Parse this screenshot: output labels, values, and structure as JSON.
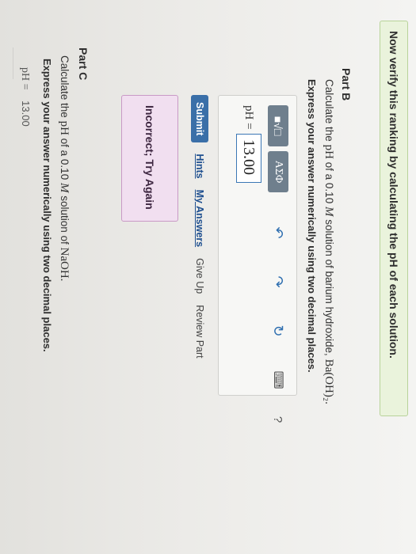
{
  "hint_banner": "Now verify this ranking by calculating the pH of each solution.",
  "part_b": {
    "heading": "Part B",
    "prompt_pre": "Calculate the ",
    "prompt_ph": "pH",
    "prompt_mid": " of a 0.10 ",
    "prompt_m": "M",
    "prompt_post": " solution of barium hydroxide, ",
    "prompt_formula": "Ba(OH)₂.",
    "instruction": "Express your answer numerically using two decimal places.",
    "toolbar": {
      "templates_label": "■√□",
      "greek_label": "ΑΣΦ",
      "undo_glyph": "↶",
      "redo_glyph": "↷",
      "reset_glyph": "↻",
      "keyboard_glyph": "⌨",
      "help_glyph": "?"
    },
    "input_label": "pH =",
    "input_value": "13.00",
    "submit_label": "Submit",
    "hints_label": "Hints",
    "my_answers_label": "My Answers",
    "give_up_label": "Give Up",
    "review_part_label": "Review Part",
    "feedback": "Incorrect; Try Again"
  },
  "part_c": {
    "heading": "Part C",
    "prompt_pre": "Calculate the ",
    "prompt_ph": "pH",
    "prompt_mid": " of a 0.10 ",
    "prompt_m": "M",
    "prompt_post": " solution of ",
    "prompt_formula": "NaOH.",
    "instruction": "Express your answer numerically using two decimal places.",
    "value_label": "pH =",
    "value": "13.00"
  }
}
